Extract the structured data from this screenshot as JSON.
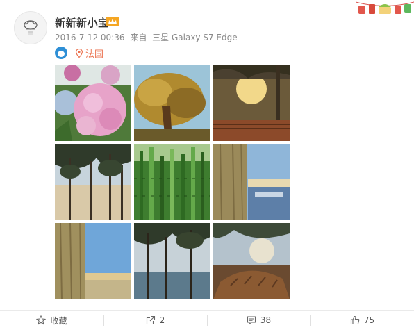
{
  "post": {
    "username": "新新新小宝",
    "time": "2016-7-12 00:36",
    "via_prefix": "来自",
    "device": "三星 Galaxy S7 Edge",
    "location": "法国",
    "badge_icon": "vip-crown-icon",
    "location_icon": "location-pin-icon"
  },
  "photos": [
    {
      "subject": "hydrangea-flowers"
    },
    {
      "subject": "tree-sunlight"
    },
    {
      "subject": "sunset-tree-bench"
    },
    {
      "subject": "pine-forest"
    },
    {
      "subject": "horsetail-plants"
    },
    {
      "subject": "tree-trunk-beach"
    },
    {
      "subject": "tree-trunk-sky"
    },
    {
      "subject": "pines-sea"
    },
    {
      "subject": "pine-cone-sunset"
    }
  ],
  "actions": {
    "favorite_label": "收藏",
    "repost_count": "2",
    "comment_count": "38",
    "like_count": "75"
  },
  "colors": {
    "location": "#eb7350",
    "meta": "#8a8a8a",
    "badge": "#f5a623"
  }
}
